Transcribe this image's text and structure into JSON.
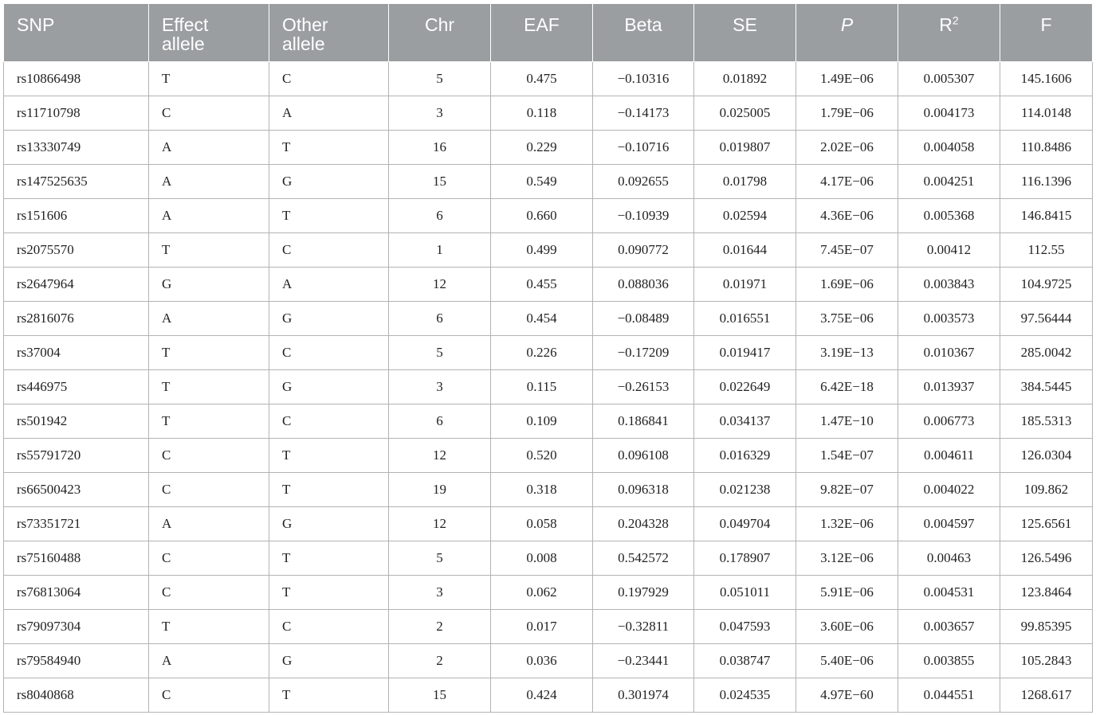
{
  "table": {
    "columns": [
      {
        "label": "SNP",
        "align": "l"
      },
      {
        "label": "Effect allele",
        "align": "l"
      },
      {
        "label": "Other allele",
        "align": "l"
      },
      {
        "label": "Chr",
        "align": "c"
      },
      {
        "label": "EAF",
        "align": "c"
      },
      {
        "label": "Beta",
        "align": "c"
      },
      {
        "label": "SE",
        "align": "c"
      },
      {
        "label": "P",
        "align": "c",
        "italic": true
      },
      {
        "label": "R",
        "sup": "2",
        "align": "c"
      },
      {
        "label": "F",
        "align": "c"
      }
    ],
    "rows": [
      [
        "rs10866498",
        "T",
        "C",
        "5",
        "0.475",
        "−0.10316",
        "0.01892",
        "1.49E−06",
        "0.005307",
        "145.1606"
      ],
      [
        "rs11710798",
        "C",
        "A",
        "3",
        "0.118",
        "−0.14173",
        "0.025005",
        "1.79E−06",
        "0.004173",
        "114.0148"
      ],
      [
        "rs13330749",
        "A",
        "T",
        "16",
        "0.229",
        "−0.10716",
        "0.019807",
        "2.02E−06",
        "0.004058",
        "110.8486"
      ],
      [
        "rs147525635",
        "A",
        "G",
        "15",
        "0.549",
        "0.092655",
        "0.01798",
        "4.17E−06",
        "0.004251",
        "116.1396"
      ],
      [
        "rs151606",
        "A",
        "T",
        "6",
        "0.660",
        "−0.10939",
        "0.02594",
        "4.36E−06",
        "0.005368",
        "146.8415"
      ],
      [
        "rs2075570",
        "T",
        "C",
        "1",
        "0.499",
        "0.090772",
        "0.01644",
        "7.45E−07",
        "0.00412",
        "112.55"
      ],
      [
        "rs2647964",
        "G",
        "A",
        "12",
        "0.455",
        "0.088036",
        "0.01971",
        "1.69E−06",
        "0.003843",
        "104.9725"
      ],
      [
        "rs2816076",
        "A",
        "G",
        "6",
        "0.454",
        "−0.08489",
        "0.016551",
        "3.75E−06",
        "0.003573",
        "97.56444"
      ],
      [
        "rs37004",
        "T",
        "C",
        "5",
        "0.226",
        "−0.17209",
        "0.019417",
        "3.19E−13",
        "0.010367",
        "285.0042"
      ],
      [
        "rs446975",
        "T",
        "G",
        "3",
        "0.115",
        "−0.26153",
        "0.022649",
        "6.42E−18",
        "0.013937",
        "384.5445"
      ],
      [
        "rs501942",
        "T",
        "C",
        "6",
        "0.109",
        "0.186841",
        "0.034137",
        "1.47E−10",
        "0.006773",
        "185.5313"
      ],
      [
        "rs55791720",
        "C",
        "T",
        "12",
        "0.520",
        "0.096108",
        "0.016329",
        "1.54E−07",
        "0.004611",
        "126.0304"
      ],
      [
        "rs66500423",
        "C",
        "T",
        "19",
        "0.318",
        "0.096318",
        "0.021238",
        "9.82E−07",
        "0.004022",
        "109.862"
      ],
      [
        "rs73351721",
        "A",
        "G",
        "12",
        "0.058",
        "0.204328",
        "0.049704",
        "1.32E−06",
        "0.004597",
        "125.6561"
      ],
      [
        "rs75160488",
        "C",
        "T",
        "5",
        "0.008",
        "0.542572",
        "0.178907",
        "3.12E−06",
        "0.00463",
        "126.5496"
      ],
      [
        "rs76813064",
        "C",
        "T",
        "3",
        "0.062",
        "0.197929",
        "0.051011",
        "5.91E−06",
        "0.004531",
        "123.8464"
      ],
      [
        "rs79097304",
        "T",
        "C",
        "2",
        "0.017",
        "−0.32811",
        "0.047593",
        "3.60E−06",
        "0.003657",
        "99.85395"
      ],
      [
        "rs79584940",
        "A",
        "G",
        "2",
        "0.036",
        "−0.23441",
        "0.038747",
        "5.40E−06",
        "0.003855",
        "105.2843"
      ],
      [
        "rs8040868",
        "C",
        "T",
        "15",
        "0.424",
        "0.301974",
        "0.024535",
        "4.97E−60",
        "0.044551",
        "1268.617"
      ]
    ]
  },
  "colors": {
    "header_bg": "#9a9ea0",
    "header_text": "#ffffff",
    "grid": "#b3b3b3",
    "cell_text": "#222222"
  }
}
